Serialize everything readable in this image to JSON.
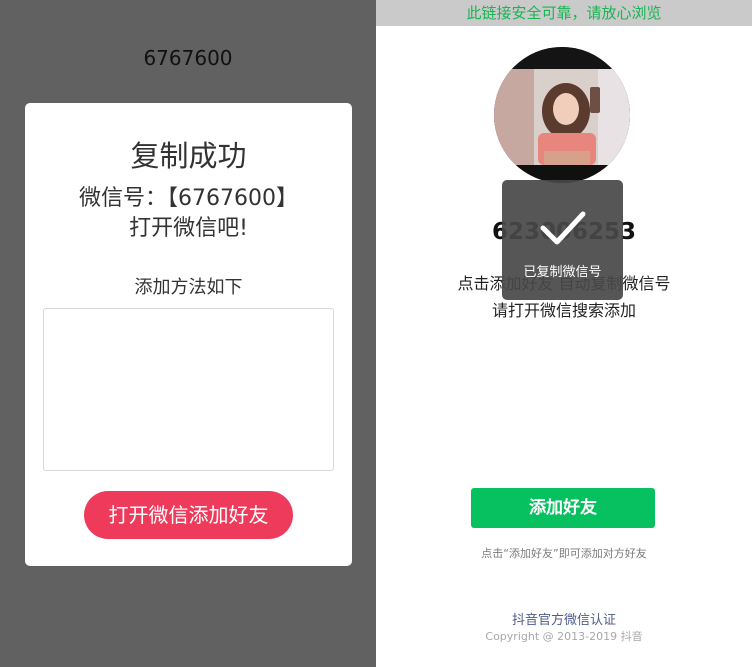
{
  "left": {
    "top_number": "6767600",
    "card": {
      "title": "复制成功",
      "wechat_line": "微信号：【6767600】",
      "open_line": "打开微信吧!",
      "method_label": "添加方法如下",
      "button_label": "打开微信添加好友"
    }
  },
  "right": {
    "banner": "此链接安全可靠，请放心浏览",
    "wechat_id": "623006253",
    "tip_line1": "点击添加好友 自动复制微信号",
    "tip_line2": "请打开微信搜索添加",
    "toast_text": "已复制微信号",
    "add_button_label": "添加好友",
    "add_hint": "点击“添加好友”即可添加对方好友",
    "footer_title": "抖音官方微信认证",
    "footer_copyright": "Copyright @ 2013-2019 抖音"
  },
  "colors": {
    "left_bg": "#616161",
    "pink_button": "#ee3b5b",
    "green_button": "#07c160",
    "banner_text": "#19b552",
    "banner_bg": "#cacaca"
  },
  "icons": {
    "toast": "checkmark-icon",
    "avatar": "profile-photo"
  }
}
